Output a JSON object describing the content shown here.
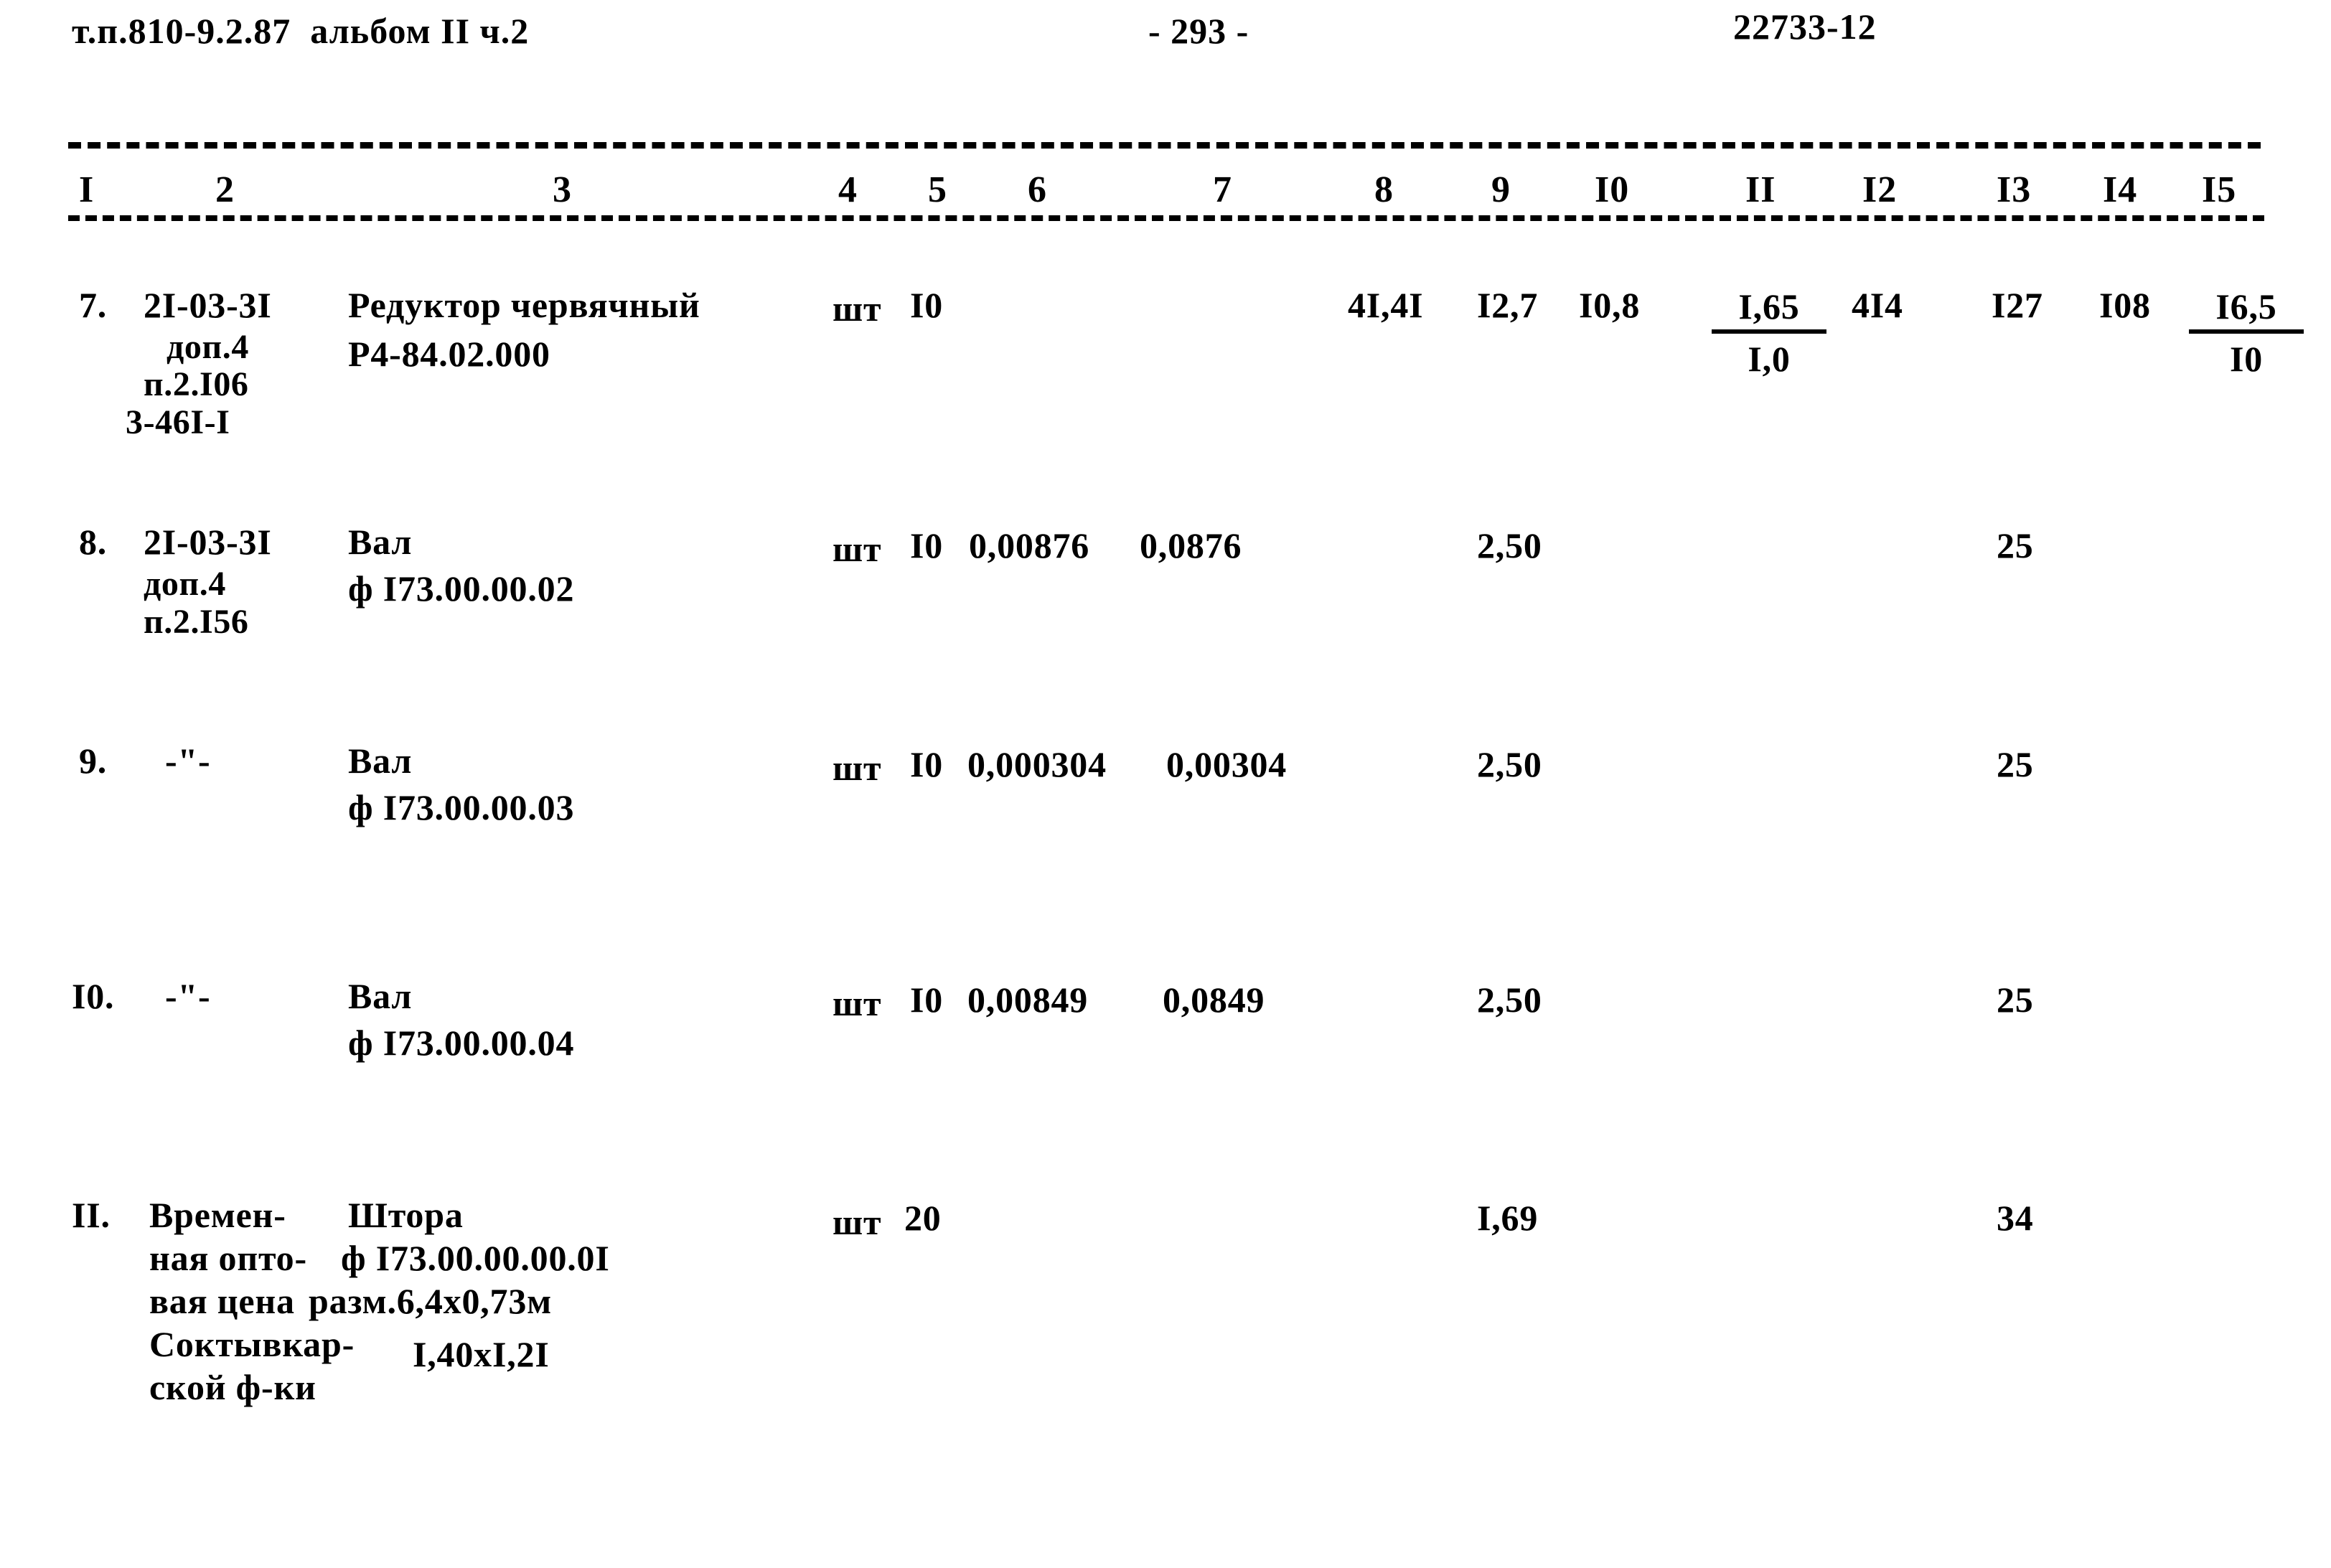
{
  "header": {
    "left": "т.п.810-9.2.87  альбом II ч.2",
    "center": "- 293 -",
    "right": "22733-12"
  },
  "table": {
    "column_numbers": [
      "I",
      "2",
      "3",
      "4",
      "5",
      "6",
      "7",
      "8",
      "9",
      "I0",
      "II",
      "I2",
      "I3",
      "I4",
      "I5"
    ],
    "rows": [
      {
        "num": "7.",
        "code_lines": [
          "2I-03-3I",
          "доп.4",
          "п.2.I06",
          "3-46I-I"
        ],
        "name_lines": [
          "Редуктор червячный",
          "Р4-84.02.000"
        ],
        "unit": "шт",
        "qty": "I0",
        "c6": "",
        "c7": "",
        "c8": "4I,4I",
        "c9": "I2,7",
        "c10": "I0,8",
        "c11_num": "I,65",
        "c11_den": "I,0",
        "c12": "4I4",
        "c13": "I27",
        "c14": "I08",
        "c15_num": "I6,5",
        "c15_den": "I0"
      },
      {
        "num": "8.",
        "code_lines": [
          "2I-03-3I",
          "доп.4",
          "п.2.I56"
        ],
        "name_lines": [
          "Вал",
          "ф I73.00.00.02"
        ],
        "unit": "шт",
        "qty": "I0",
        "c6": "0,00876",
        "c7": "0,0876",
        "c9": "2,50",
        "c13": "25"
      },
      {
        "num": "9.",
        "code_lines": [
          "-\"-"
        ],
        "name_lines": [
          "Вал",
          "ф I73.00.00.03"
        ],
        "unit": "шт",
        "qty": "I0",
        "c6": "0,000304",
        "c7": "0,00304",
        "c9": "2,50",
        "c13": "25"
      },
      {
        "num": "I0.",
        "code_lines": [
          "-\"-"
        ],
        "name_lines": [
          "Вал",
          "ф I73.00.00.04"
        ],
        "unit": "шт",
        "qty": "I0",
        "c6": "0,00849",
        "c7": "0,0849",
        "c9": "2,50",
        "c13": "25"
      },
      {
        "num": "II.",
        "code_lines": [
          "Времен-",
          "ная опто-",
          "вая цена",
          "Соктывкар-",
          "ской ф-ки"
        ],
        "name_lines": [
          "Штора",
          "ф I73.00.00.00.0I",
          "разм.6,4х0,73м",
          "I,40хI,2I"
        ],
        "unit": "шт",
        "qty": "20",
        "c9": "I,69",
        "c13": "34"
      }
    ]
  },
  "colors": {
    "ink": "#000000",
    "paper": "#ffffff"
  }
}
